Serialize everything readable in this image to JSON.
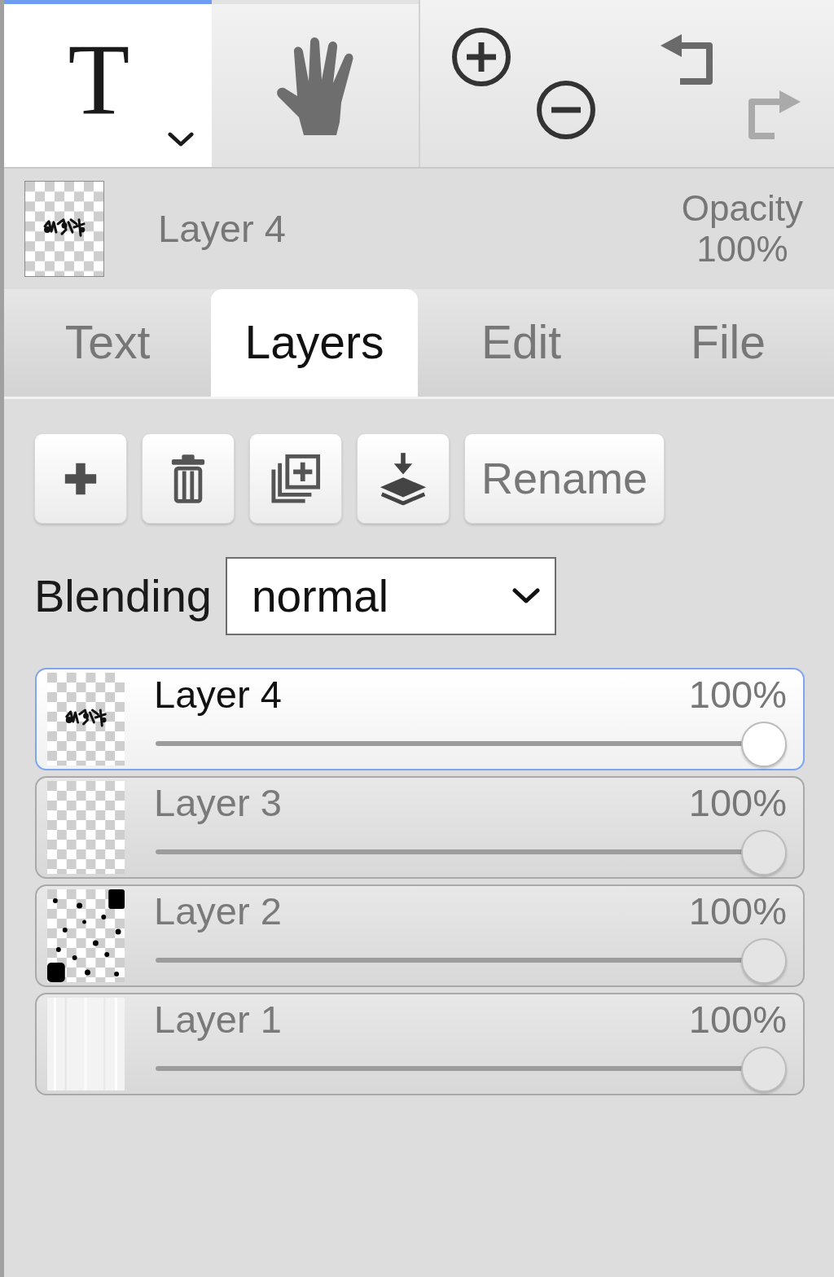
{
  "toolbar": {
    "tools": [
      {
        "kind": "text",
        "glyph": "T",
        "has_menu": true,
        "selected": true
      },
      {
        "kind": "hand",
        "has_menu": false,
        "selected": false
      }
    ],
    "actions": [
      {
        "kind": "zoom_in",
        "disabled": false
      },
      {
        "kind": "zoom_out",
        "disabled": false
      },
      {
        "kind": "undo",
        "disabled": false
      },
      {
        "kind": "redo",
        "disabled": true
      }
    ]
  },
  "current_layer": {
    "thumbnail": {
      "kind": "ink"
    },
    "name": "Layer 4",
    "opacity_label": "Opacity",
    "opacity_value": "100%"
  },
  "tabs": [
    {
      "label": "Text",
      "selected": false
    },
    {
      "label": "Layers",
      "selected": true
    },
    {
      "label": "Edit",
      "selected": false
    },
    {
      "label": "File",
      "selected": false
    }
  ],
  "layer_actions": [
    {
      "kind": "add"
    },
    {
      "kind": "delete"
    },
    {
      "kind": "duplicate"
    },
    {
      "kind": "merge_down"
    },
    {
      "kind": "rename",
      "label": "Rename"
    }
  ],
  "blending": {
    "label": "Blending",
    "value": "normal"
  },
  "layers": [
    {
      "name": "Layer 4",
      "thumbnail": {
        "kind": "ink"
      },
      "opacity": "100%",
      "level": 1,
      "selected": true
    },
    {
      "name": "Layer 3",
      "thumbnail": {
        "kind": "empty"
      },
      "opacity": "100%",
      "level": 1,
      "selected": false
    },
    {
      "name": "Layer 2",
      "thumbnail": {
        "kind": "dots"
      },
      "opacity": "100%",
      "level": 1,
      "selected": false
    },
    {
      "name": "Layer 1",
      "thumbnail": {
        "kind": "white"
      },
      "opacity": "100%",
      "level": 1,
      "selected": false
    }
  ]
}
